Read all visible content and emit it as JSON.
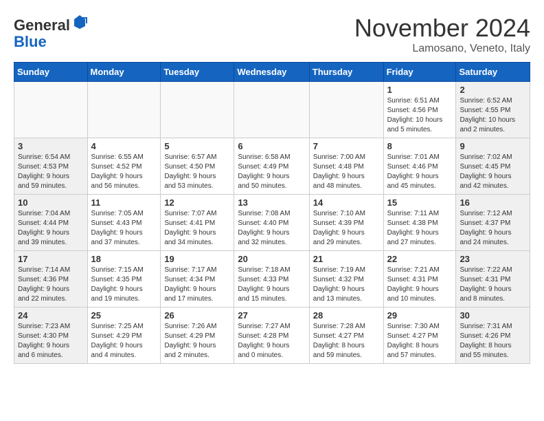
{
  "header": {
    "logo_general": "General",
    "logo_blue": "Blue",
    "month_title": "November 2024",
    "location": "Lamosano, Veneto, Italy"
  },
  "days_of_week": [
    "Sunday",
    "Monday",
    "Tuesday",
    "Wednesday",
    "Thursday",
    "Friday",
    "Saturday"
  ],
  "weeks": [
    [
      {
        "day": "",
        "info": ""
      },
      {
        "day": "",
        "info": ""
      },
      {
        "day": "",
        "info": ""
      },
      {
        "day": "",
        "info": ""
      },
      {
        "day": "",
        "info": ""
      },
      {
        "day": "1",
        "info": "Sunrise: 6:51 AM\nSunset: 4:56 PM\nDaylight: 10 hours\nand 5 minutes."
      },
      {
        "day": "2",
        "info": "Sunrise: 6:52 AM\nSunset: 4:55 PM\nDaylight: 10 hours\nand 2 minutes."
      }
    ],
    [
      {
        "day": "3",
        "info": "Sunrise: 6:54 AM\nSunset: 4:53 PM\nDaylight: 9 hours\nand 59 minutes."
      },
      {
        "day": "4",
        "info": "Sunrise: 6:55 AM\nSunset: 4:52 PM\nDaylight: 9 hours\nand 56 minutes."
      },
      {
        "day": "5",
        "info": "Sunrise: 6:57 AM\nSunset: 4:50 PM\nDaylight: 9 hours\nand 53 minutes."
      },
      {
        "day": "6",
        "info": "Sunrise: 6:58 AM\nSunset: 4:49 PM\nDaylight: 9 hours\nand 50 minutes."
      },
      {
        "day": "7",
        "info": "Sunrise: 7:00 AM\nSunset: 4:48 PM\nDaylight: 9 hours\nand 48 minutes."
      },
      {
        "day": "8",
        "info": "Sunrise: 7:01 AM\nSunset: 4:46 PM\nDaylight: 9 hours\nand 45 minutes."
      },
      {
        "day": "9",
        "info": "Sunrise: 7:02 AM\nSunset: 4:45 PM\nDaylight: 9 hours\nand 42 minutes."
      }
    ],
    [
      {
        "day": "10",
        "info": "Sunrise: 7:04 AM\nSunset: 4:44 PM\nDaylight: 9 hours\nand 39 minutes."
      },
      {
        "day": "11",
        "info": "Sunrise: 7:05 AM\nSunset: 4:43 PM\nDaylight: 9 hours\nand 37 minutes."
      },
      {
        "day": "12",
        "info": "Sunrise: 7:07 AM\nSunset: 4:41 PM\nDaylight: 9 hours\nand 34 minutes."
      },
      {
        "day": "13",
        "info": "Sunrise: 7:08 AM\nSunset: 4:40 PM\nDaylight: 9 hours\nand 32 minutes."
      },
      {
        "day": "14",
        "info": "Sunrise: 7:10 AM\nSunset: 4:39 PM\nDaylight: 9 hours\nand 29 minutes."
      },
      {
        "day": "15",
        "info": "Sunrise: 7:11 AM\nSunset: 4:38 PM\nDaylight: 9 hours\nand 27 minutes."
      },
      {
        "day": "16",
        "info": "Sunrise: 7:12 AM\nSunset: 4:37 PM\nDaylight: 9 hours\nand 24 minutes."
      }
    ],
    [
      {
        "day": "17",
        "info": "Sunrise: 7:14 AM\nSunset: 4:36 PM\nDaylight: 9 hours\nand 22 minutes."
      },
      {
        "day": "18",
        "info": "Sunrise: 7:15 AM\nSunset: 4:35 PM\nDaylight: 9 hours\nand 19 minutes."
      },
      {
        "day": "19",
        "info": "Sunrise: 7:17 AM\nSunset: 4:34 PM\nDaylight: 9 hours\nand 17 minutes."
      },
      {
        "day": "20",
        "info": "Sunrise: 7:18 AM\nSunset: 4:33 PM\nDaylight: 9 hours\nand 15 minutes."
      },
      {
        "day": "21",
        "info": "Sunrise: 7:19 AM\nSunset: 4:32 PM\nDaylight: 9 hours\nand 13 minutes."
      },
      {
        "day": "22",
        "info": "Sunrise: 7:21 AM\nSunset: 4:31 PM\nDaylight: 9 hours\nand 10 minutes."
      },
      {
        "day": "23",
        "info": "Sunrise: 7:22 AM\nSunset: 4:31 PM\nDaylight: 9 hours\nand 8 minutes."
      }
    ],
    [
      {
        "day": "24",
        "info": "Sunrise: 7:23 AM\nSunset: 4:30 PM\nDaylight: 9 hours\nand 6 minutes."
      },
      {
        "day": "25",
        "info": "Sunrise: 7:25 AM\nSunset: 4:29 PM\nDaylight: 9 hours\nand 4 minutes."
      },
      {
        "day": "26",
        "info": "Sunrise: 7:26 AM\nSunset: 4:29 PM\nDaylight: 9 hours\nand 2 minutes."
      },
      {
        "day": "27",
        "info": "Sunrise: 7:27 AM\nSunset: 4:28 PM\nDaylight: 9 hours\nand 0 minutes."
      },
      {
        "day": "28",
        "info": "Sunrise: 7:28 AM\nSunset: 4:27 PM\nDaylight: 8 hours\nand 59 minutes."
      },
      {
        "day": "29",
        "info": "Sunrise: 7:30 AM\nSunset: 4:27 PM\nDaylight: 8 hours\nand 57 minutes."
      },
      {
        "day": "30",
        "info": "Sunrise: 7:31 AM\nSunset: 4:26 PM\nDaylight: 8 hours\nand 55 minutes."
      }
    ]
  ]
}
